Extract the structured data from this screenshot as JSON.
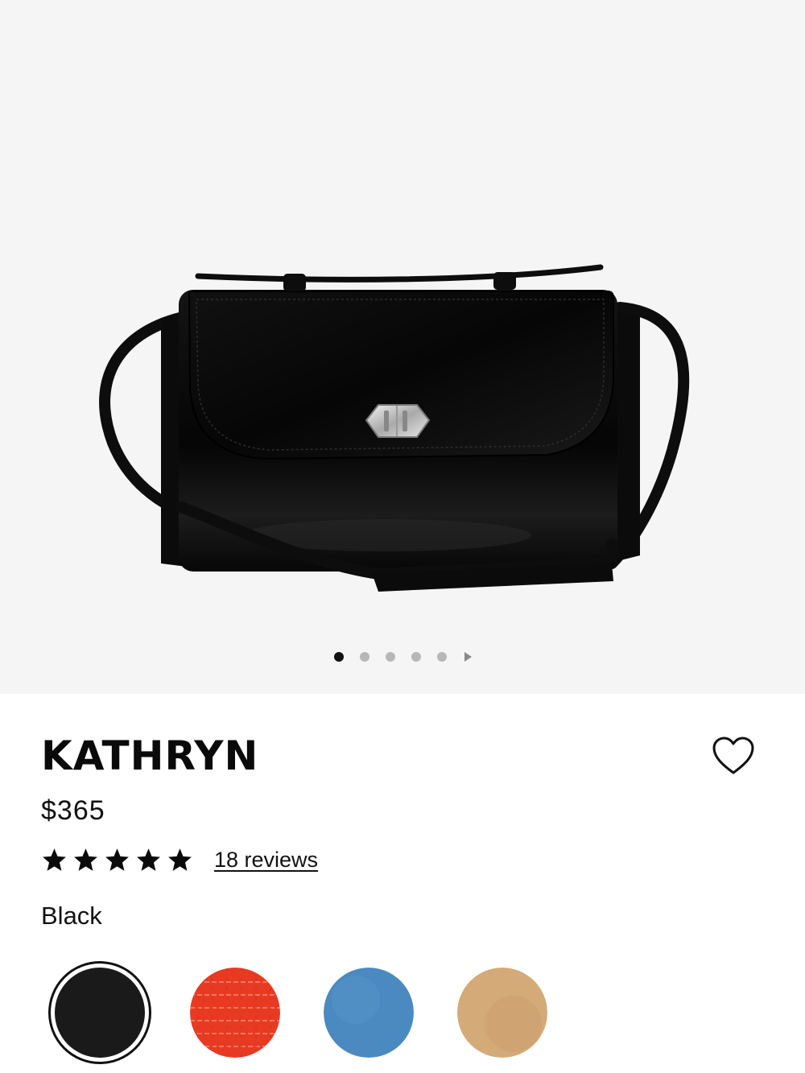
{
  "product": {
    "name": "KATHRYN",
    "price": "$365",
    "rating": 5,
    "reviews_label": "18 reviews",
    "selected_color": "Black"
  },
  "gallery": {
    "image_count": 5,
    "active_index": 0,
    "background": "#f5f5f5"
  },
  "swatches": [
    {
      "name": "black",
      "color": "#1a1a1a",
      "selected": true
    },
    {
      "name": "red-lizard",
      "color": "#e83a22",
      "selected": false
    },
    {
      "name": "blue",
      "color": "#4b8ac0",
      "selected": false
    },
    {
      "name": "tan",
      "color": "#d4aa78",
      "selected": false
    }
  ],
  "icons": {
    "favorite": "heart-outline-icon",
    "rating": "star-icon",
    "next": "triangle-right-icon"
  }
}
